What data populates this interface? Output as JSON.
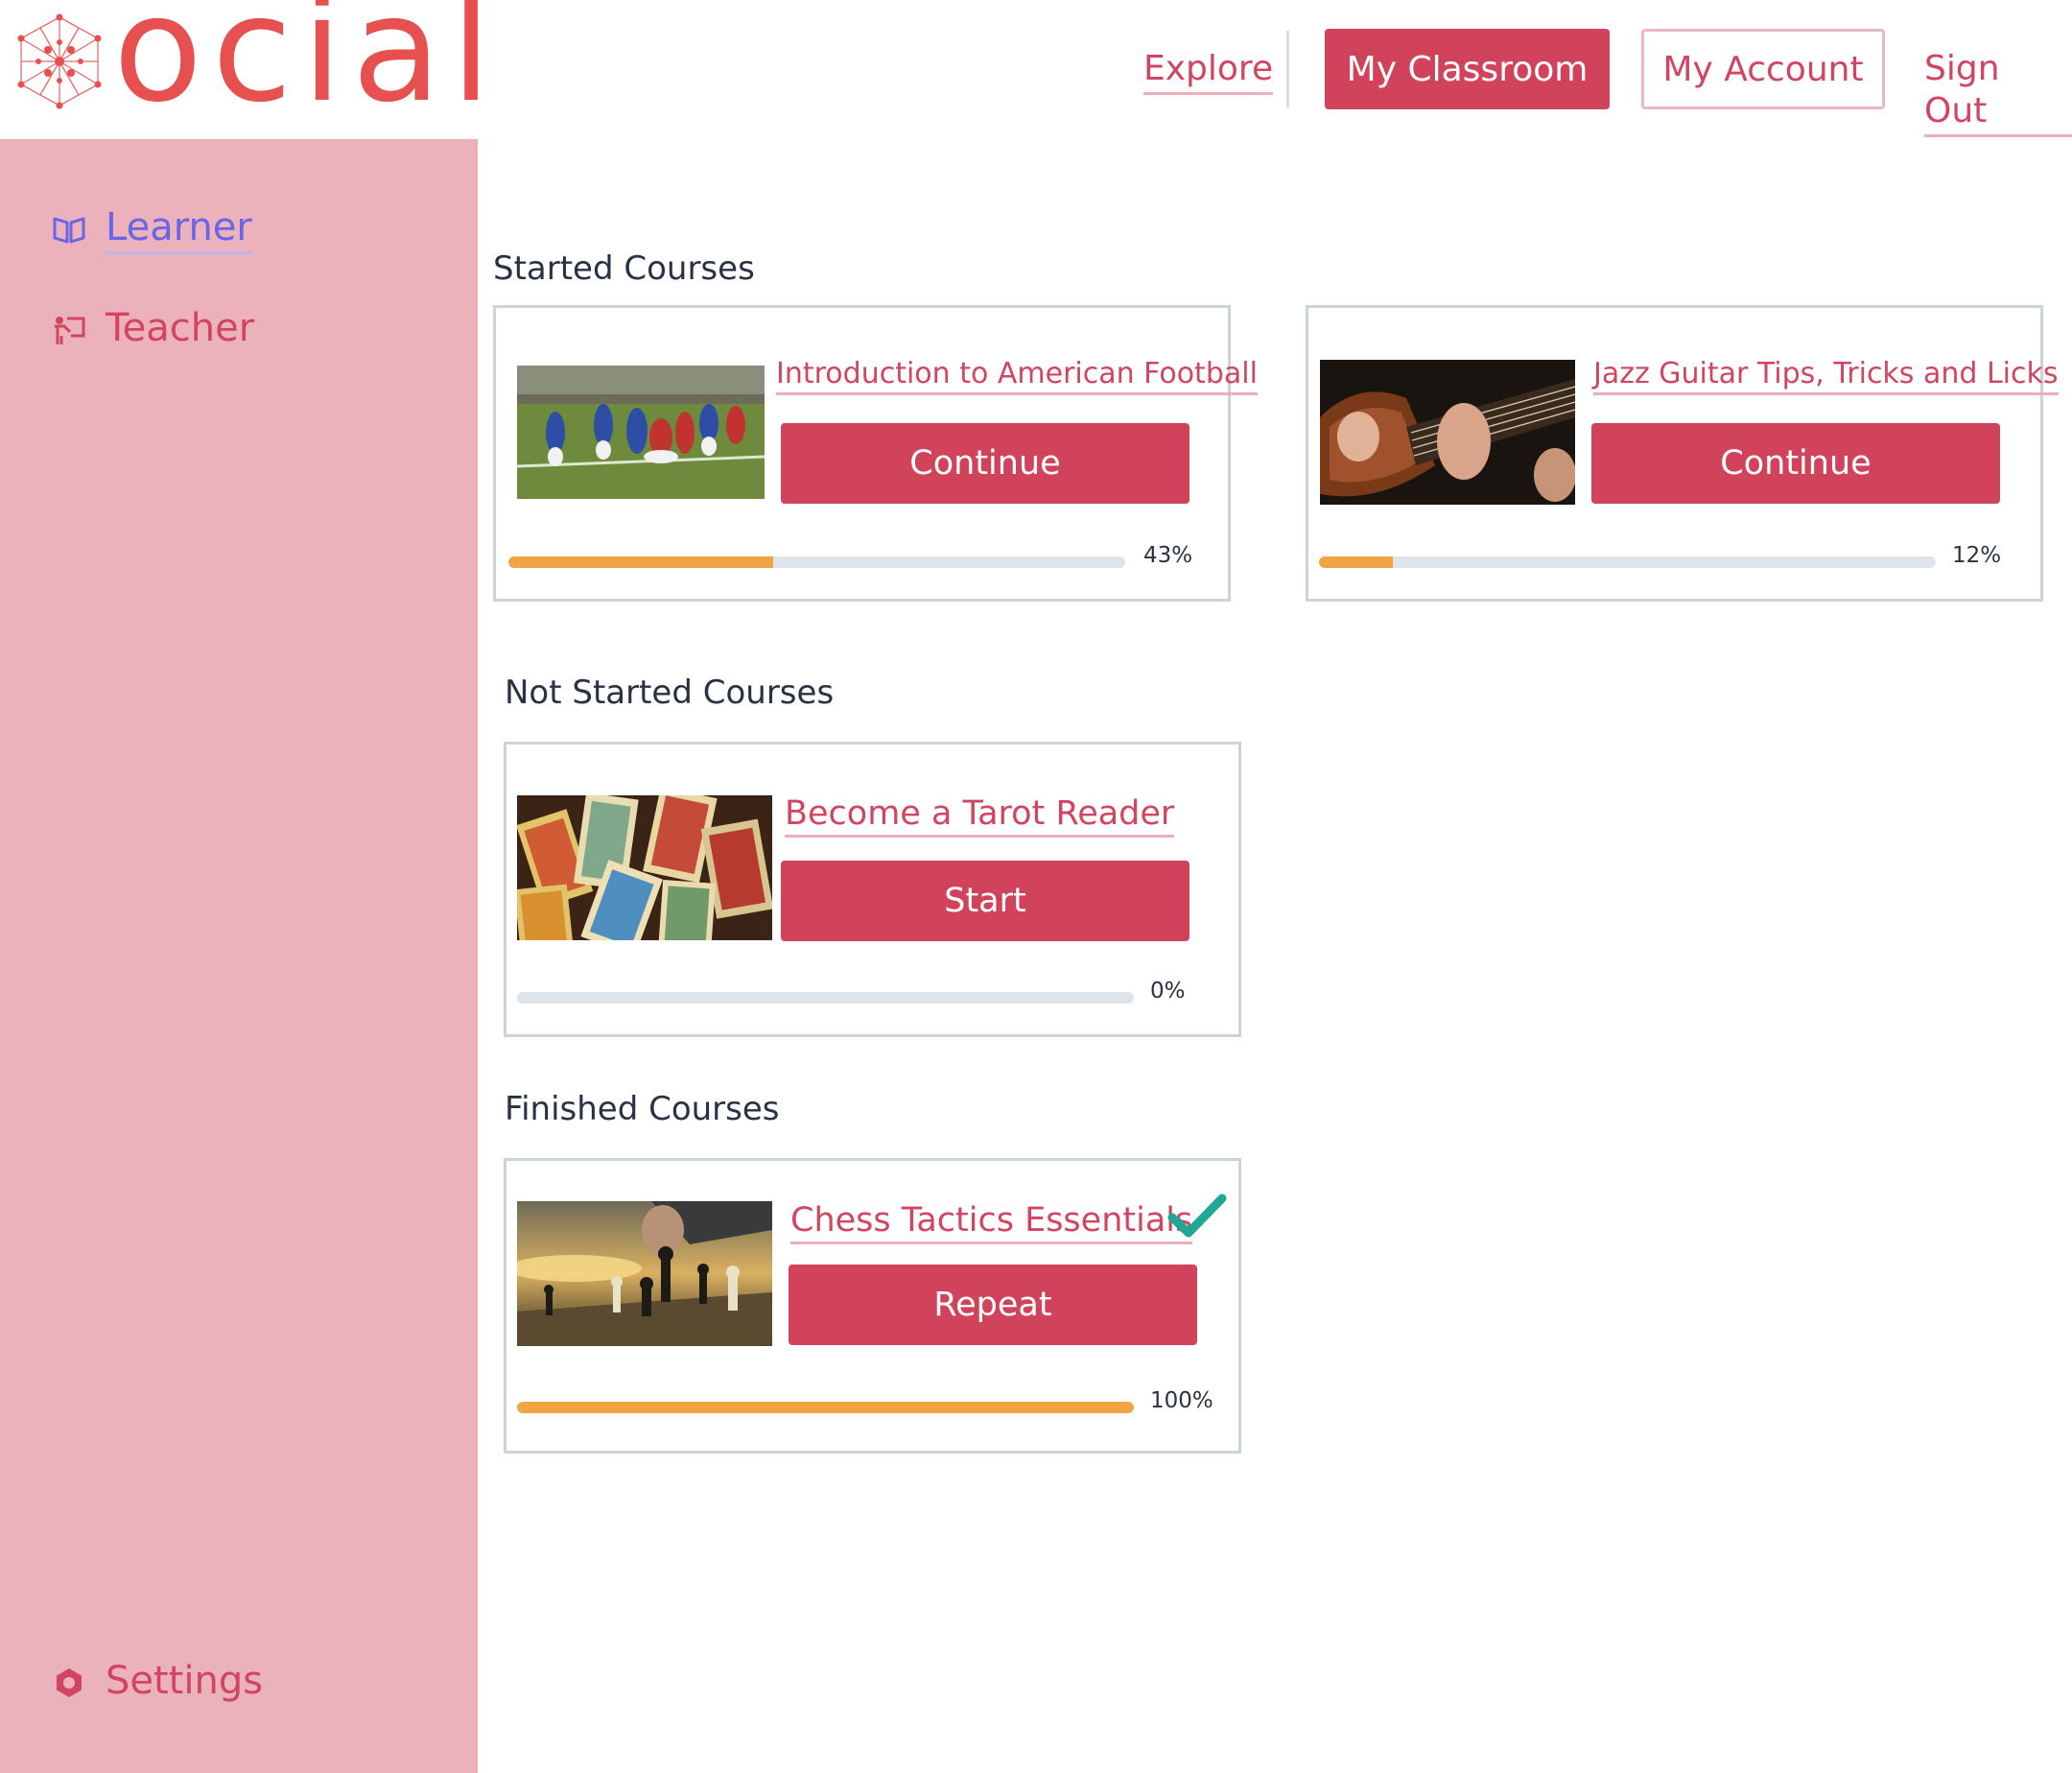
{
  "brand": {
    "logo_text": "ocial",
    "color": "#e6514f"
  },
  "nav": {
    "explore": "Explore",
    "my_classroom": "My Classroom",
    "my_account": "My Account",
    "sign_out": "Sign Out"
  },
  "sidebar": {
    "items": [
      {
        "label": "Learner",
        "icon": "open-book-icon",
        "active": true
      },
      {
        "label": "Teacher",
        "icon": "teacher-board-icon",
        "active": false
      }
    ],
    "settings": {
      "label": "Settings",
      "icon": "hexagon-gear-icon"
    }
  },
  "sections": {
    "started": {
      "title": "Started Courses",
      "courses": [
        {
          "title": "Introduction to American Football",
          "action": "Continue",
          "progress": 0.43,
          "progress_label": "43%",
          "image": "american-football-photo"
        },
        {
          "title": "Jazz Guitar Tips, Tricks and Licks",
          "action": "Continue",
          "progress": 0.12,
          "progress_label": "12%",
          "image": "guitar-photo"
        }
      ]
    },
    "not_started": {
      "title": "Not Started Courses",
      "courses": [
        {
          "title": "Become a Tarot Reader",
          "action": "Start",
          "progress": 0,
          "progress_label": "0%",
          "image": "tarot-cards-photo"
        }
      ]
    },
    "finished": {
      "title": "Finished Courses",
      "courses": [
        {
          "title": "Chess Tactics Essentials",
          "action": "Repeat",
          "progress": 1,
          "progress_label": "100%",
          "image": "chess-photo",
          "completed": true
        }
      ]
    }
  },
  "colors": {
    "accent": "#d1435b",
    "sidebar_bg": "#ecb2bb",
    "active_nav": "#6b63e8",
    "progress_fill": "#f0a444",
    "progress_track": "#dfe4ea",
    "check": "#1fa896"
  }
}
